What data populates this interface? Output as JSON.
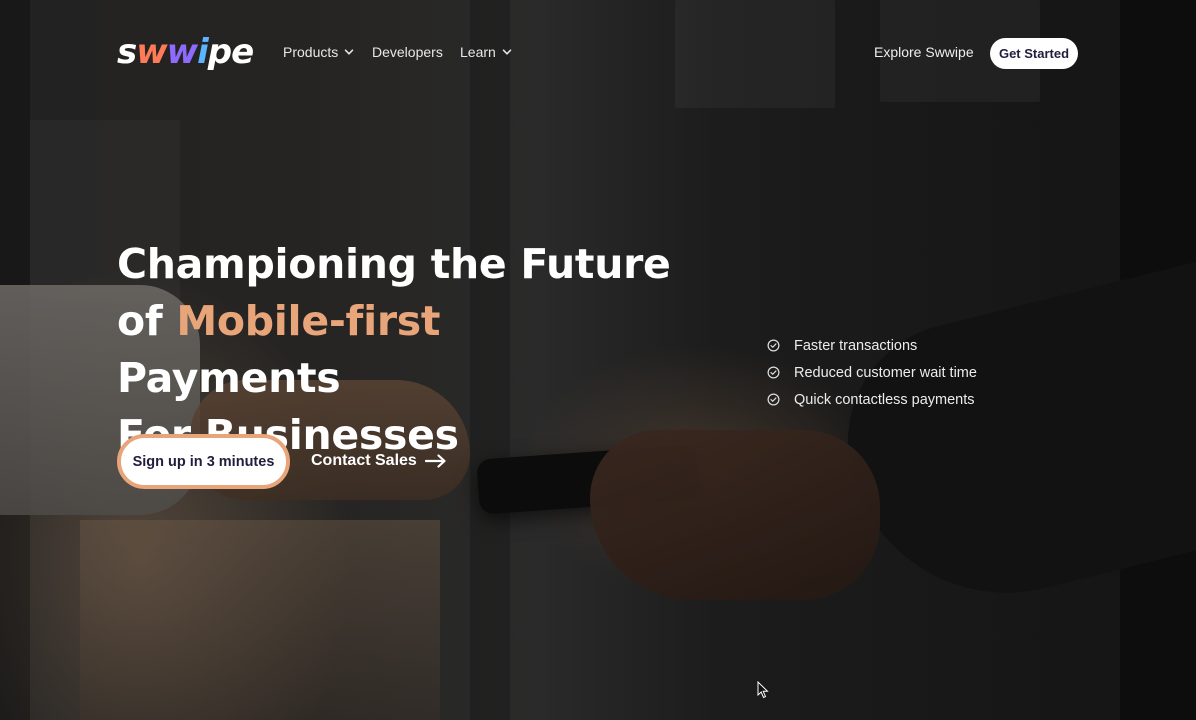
{
  "brand": {
    "logo_text_1": "s",
    "logo_w1": "w",
    "logo_w2": "w",
    "logo_w3": "i",
    "logo_text_2": "pe",
    "accent_color": "#e9a57a"
  },
  "nav": {
    "items": [
      {
        "label": "Products",
        "dropdown": true
      },
      {
        "label": "Developers",
        "dropdown": false
      },
      {
        "label": "Learn",
        "dropdown": true
      }
    ],
    "explore_label": "Explore Swwipe",
    "cta_label": "Get Started"
  },
  "hero": {
    "title_line1": "Championing the Future",
    "title_line2_prefix": "of ",
    "title_line2_accent": "Mobile-first",
    "title_line2_suffix": " Payments",
    "title_line3": "For Businesses",
    "primary_cta": "Sign up in 3 minutes",
    "secondary_cta": "Contact Sales",
    "secondary_icon": "arrow-right-icon"
  },
  "features": [
    {
      "label": "Faster transactions",
      "icon": "check-circle-icon"
    },
    {
      "label": "Reduced customer wait time",
      "icon": "check-circle-icon"
    },
    {
      "label": "Quick contactless payments",
      "icon": "check-circle-icon"
    }
  ]
}
